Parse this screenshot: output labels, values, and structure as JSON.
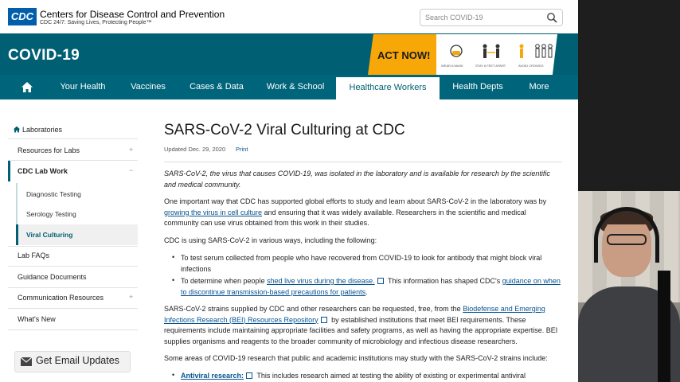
{
  "header": {
    "logo": "CDC",
    "org_name": "Centers for Disease Control and Prevention",
    "org_tagline": "CDC 24/7: Saving Lives, Protecting People™",
    "search_placeholder": "Search COVID-19"
  },
  "band": {
    "title": "COVID-19",
    "act_now": "ACT NOW!",
    "act_captions": [
      "WEAR A MASK",
      "STAY 6 FEET APART",
      "AVOID CROWDS"
    ]
  },
  "nav": {
    "items": [
      "Your Health",
      "Vaccines",
      "Cases & Data",
      "Work & School",
      "Healthcare Workers",
      "Health Depts",
      "More"
    ],
    "active": "Healthcare Workers"
  },
  "sidebar": {
    "parent": "Laboratories",
    "items": [
      {
        "label": "Resources for Labs",
        "expand": "+"
      },
      {
        "label": "CDC Lab Work",
        "expand": "−"
      },
      {
        "label": "Diagnostic Testing"
      },
      {
        "label": "Serology Testing"
      },
      {
        "label": "Viral Culturing"
      },
      {
        "label": "Lab FAQs"
      },
      {
        "label": "Guidance Documents"
      },
      {
        "label": "Communication Resources",
        "expand": "+"
      },
      {
        "label": "What's New"
      }
    ],
    "email_button": "Get Email Updates"
  },
  "content": {
    "title": "SARS-CoV-2 Viral Culturing at CDC",
    "updated": "Updated Dec. 29, 2020",
    "print": "Print",
    "intro": "SARS-CoV-2, the virus that causes COVID-19, was isolated in the laboratory and is available for research by the scientific and medical community.",
    "p1_a": "One important way that CDC has supported global efforts to study and learn about SARS-CoV-2 in the laboratory was by ",
    "p1_link": "growing the virus in cell culture",
    "p1_b": " and ensuring that it was widely available. Researchers in the scientific and medical community can use virus obtained from this work in their studies.",
    "p2": "CDC is using SARS-CoV-2 in various ways, including the following:",
    "li1": "To test serum collected from people who have recovered from COVID-19 to look for antibody that might block viral infections",
    "li2_a": "To determine when people ",
    "li2_link1": "shed live virus during the disease.",
    "li2_b": " This information has shaped CDC's ",
    "li2_link2": "guidance on when to discontinue transmission-based precautions for patients",
    "li2_c": ".",
    "p3_a": "SARS-CoV-2 strains supplied by CDC and other researchers can be requested, free, from the ",
    "p3_link": "Biodefense and Emerging Infections Research (BEI) Resources Repository",
    "p3_b": " by established institutions that meet BEI requirements. These requirements include maintaining appropriate facilities and safety programs, as well as having the appropriate expertise. BEI supplies organisms and reagents to the broader community of microbiology and infectious disease researchers.",
    "p4": "Some areas of COVID-19 research that public and academic institutions may study with the SARS-CoV-2 strains include:",
    "li3_link": "Antiviral research:",
    "li3_text": " This includes research aimed at testing the ability of existing or experimental antiviral"
  }
}
